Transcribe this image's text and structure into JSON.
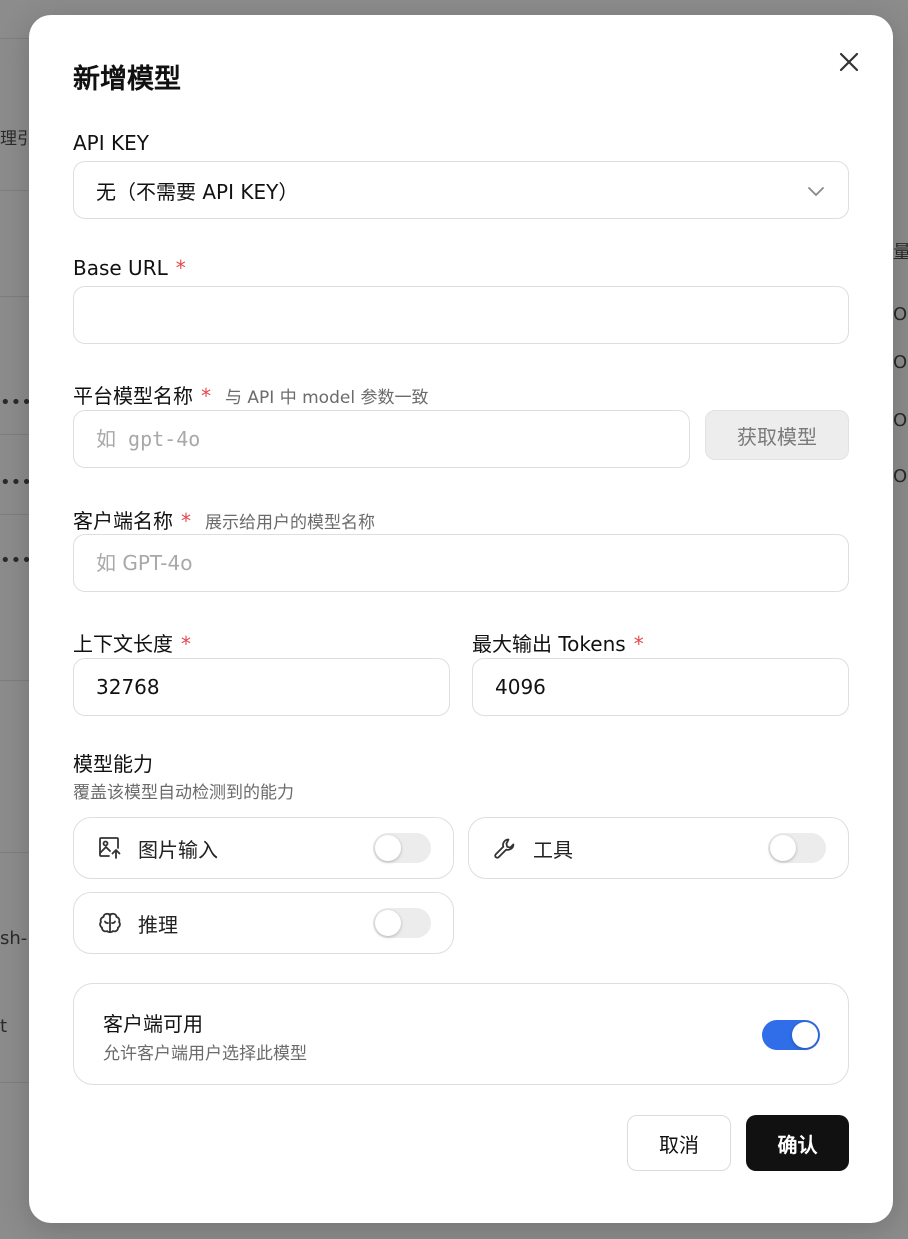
{
  "modal": {
    "title": "新增模型",
    "api_key": {
      "label": "API KEY",
      "selected": "无（不需要 API KEY）"
    },
    "base_url": {
      "label": "Base URL",
      "required_mark": "*",
      "value": ""
    },
    "platform_model": {
      "label": "平台模型名称",
      "required_mark": "*",
      "hint": "与 API 中 model 参数一致",
      "placeholder": "如 gpt-4o",
      "fetch_label": "获取模型"
    },
    "client_name": {
      "label": "客户端名称",
      "required_mark": "*",
      "hint": "展示给用户的模型名称",
      "placeholder": "如 GPT-4o"
    },
    "context_length": {
      "label": "上下文长度",
      "required_mark": "*",
      "value": "32768"
    },
    "max_output": {
      "label": "最大输出 Tokens",
      "required_mark": "*",
      "value": "4096"
    },
    "capabilities": {
      "title": "模型能力",
      "subtitle": "覆盖该模型自动检测到的能力",
      "items": [
        {
          "label": "图片输入",
          "icon": "image-upload-icon",
          "enabled": false
        },
        {
          "label": "工具",
          "icon": "wrench-icon",
          "enabled": false
        },
        {
          "label": "推理",
          "icon": "brain-icon",
          "enabled": false
        }
      ]
    },
    "client_available": {
      "title": "客户端可用",
      "subtitle": "允许客户端用户选择此模型",
      "enabled": true
    },
    "cancel_label": "取消",
    "confirm_label": "确认"
  },
  "background": {
    "fragments": [
      "理引",
      "量",
      "ON",
      "ON",
      "ON",
      "ON",
      "•••",
      "•••",
      "•••",
      "sh-",
      "t"
    ]
  },
  "colors": {
    "accent": "#2f6ee8",
    "required": "#e5484d",
    "primary_button": "#111111"
  }
}
